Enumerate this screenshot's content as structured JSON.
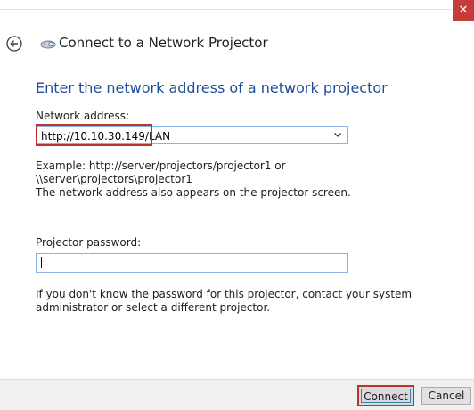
{
  "window": {
    "title": "Connect to a Network Projector",
    "close_glyph": "✕"
  },
  "form": {
    "heading": "Enter the network address of a network projector",
    "address_label": "Network address:",
    "address_value": "http://10.10.30.149/LAN",
    "example_line1": "Example: http://server/projectors/projector1 or",
    "example_line2": "\\\\server\\projectors\\projector1",
    "example_line3": "The network address also appears on the projector screen.",
    "password_label": "Projector password:",
    "password_value": "",
    "help_line1": "If you don't know the password for this projector, contact your system",
    "help_line2": "administrator or select a different projector."
  },
  "buttons": {
    "connect": "Connect",
    "cancel": "Cancel"
  },
  "colors": {
    "heading": "#1f4e9a",
    "highlight": "#b8352e",
    "field_border": "#8cb4e0"
  },
  "icons": [
    "back-arrow-icon",
    "projector-icon",
    "close-icon",
    "chevron-down-icon"
  ]
}
